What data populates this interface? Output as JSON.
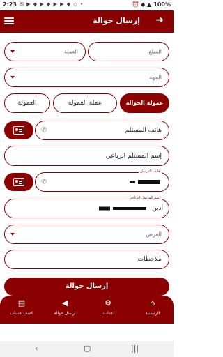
{
  "status": {
    "time": "2:23",
    "left_icons": "✉ ▶ ◆ ▶ ◆ ▶ ▶ ◆ ◇ •",
    "battery": "100%",
    "right_icons": "⏰ ◆ ▲"
  },
  "header": {
    "title": "إرسال حوالة",
    "back_icon": "arrow-right-icon",
    "menu_icon": "menu-icon"
  },
  "form": {
    "amount_placeholder": "المبلغ",
    "currency_placeholder": "العملة",
    "destination_placeholder": "الجهة",
    "commission_tabs": [
      {
        "label": "العمولة"
      },
      {
        "label": "عملة العمولة"
      },
      {
        "label": "عمولة الحوالة"
      }
    ],
    "receiver_phone_placeholder": "هاتف المستلم",
    "receiver_name_placeholder": "إسم المستلم الرباعي",
    "sender_phone_label": "هاتف المرسل",
    "sender_name_label": "إسم المرسل الرباعي",
    "sender_name_value": "أدين",
    "purpose_placeholder": "الغرض",
    "notes_placeholder": "ملاحظات",
    "submit_label": "إرسال حوالة"
  },
  "bottom_nav": [
    {
      "label": "الرئيسية",
      "icon": "home-icon"
    },
    {
      "label": "اعدادت",
      "icon": "gear-icon"
    },
    {
      "label": "ارسال حوالة",
      "icon": "send-icon"
    },
    {
      "label": "كشف حساب",
      "icon": "book-icon"
    }
  ],
  "colors": {
    "accent": "#8b0000"
  }
}
